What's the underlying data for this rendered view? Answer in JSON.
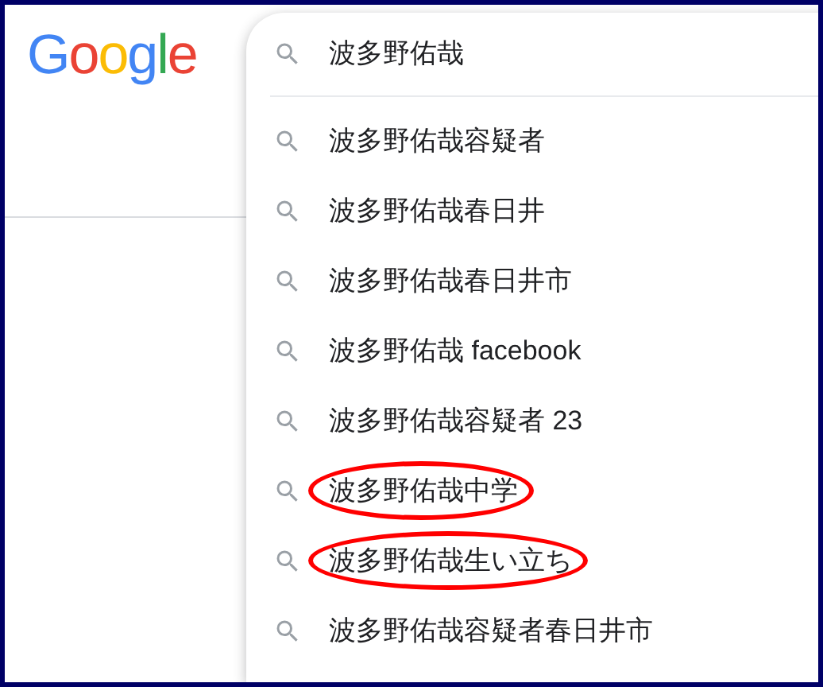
{
  "logo": {
    "text": "Google"
  },
  "search": {
    "value": "波多野佑哉"
  },
  "suggestions": [
    {
      "text": "波多野佑哉容疑者",
      "circled": false
    },
    {
      "text": "波多野佑哉春日井",
      "circled": false
    },
    {
      "text": "波多野佑哉春日井市",
      "circled": false
    },
    {
      "text": "波多野佑哉 facebook",
      "circled": false
    },
    {
      "text": "波多野佑哉容疑者 23",
      "circled": false
    },
    {
      "text": "波多野佑哉中学",
      "circled": true
    },
    {
      "text": "波多野佑哉生い立ち",
      "circled": true
    },
    {
      "text": "波多野佑哉容疑者春日井市",
      "circled": false
    }
  ]
}
